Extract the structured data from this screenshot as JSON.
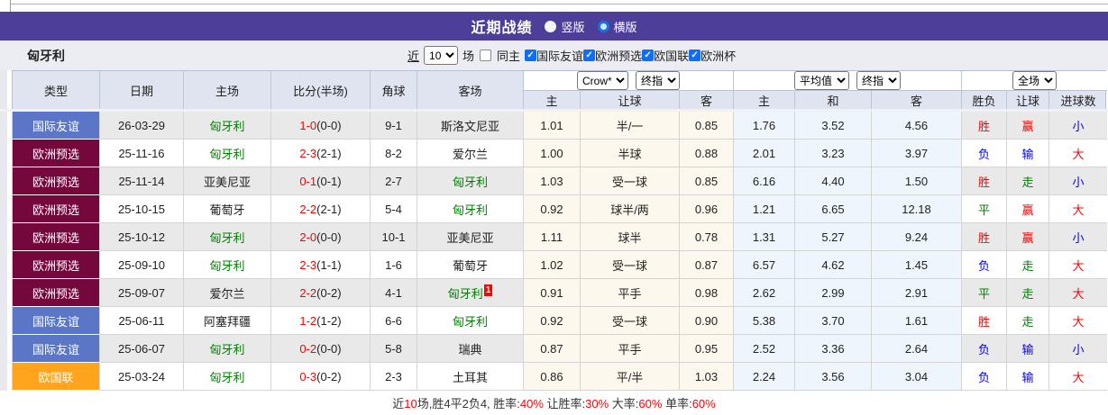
{
  "palette": {
    "accent_purple": "#4d3e99",
    "focus_team_green": "#008000",
    "score_red": "#ff0000",
    "result_colors": {
      "red": "#ff0000",
      "blue": "#0000ff",
      "green": "#008000"
    },
    "type_colors": {
      "friendly": "#5b76c6",
      "qualifier": "#74083d",
      "nations_league": "#ffa41c"
    }
  },
  "title_bar": {
    "title": "近期战绩",
    "radio_vertical_label": "竖版",
    "radio_horizontal_label": "横版"
  },
  "filter": {
    "team_name": "匈牙利",
    "near_label": "近",
    "count_value": "10",
    "unit_label": "场",
    "same_home_label": "同主",
    "competitions": [
      "国际友谊",
      "欧洲预选",
      "欧国联",
      "欧洲杯"
    ]
  },
  "table": {
    "selects": {
      "bookmaker": "Crow*",
      "handicap_index": "终指",
      "average": "平均值",
      "europe_index": "终指",
      "scope": "全场"
    },
    "headers": {
      "type": "类型",
      "date": "日期",
      "home": "主场",
      "score": "比分(半场)",
      "corner": "角球",
      "away": "客场",
      "handicap": [
        "主",
        "让球",
        "客"
      ],
      "europe": [
        "主",
        "和",
        "客"
      ],
      "outcome": [
        "胜负",
        "让球",
        "进球数"
      ]
    },
    "rows": [
      {
        "type_label": "国际友谊",
        "type_key": "friendly",
        "date": "26-03-29",
        "home": "匈牙利",
        "home_focus": true,
        "home_red_card": "",
        "score_ft": "1-0",
        "score_ht": "(0-0)",
        "corners": "9-1",
        "away": "斯洛文尼亚",
        "away_focus": false,
        "away_red_card": "",
        "handicap": [
          "1.01",
          "半/一",
          "0.85"
        ],
        "europe": [
          "1.76",
          "3.52",
          "4.56"
        ],
        "outcome": [
          {
            "text": "胜",
            "color": "red"
          },
          {
            "text": "赢",
            "color": "red"
          },
          {
            "text": "小",
            "color": "blue"
          }
        ]
      },
      {
        "type_label": "欧洲预选",
        "type_key": "qualifier",
        "date": "25-11-16",
        "home": "匈牙利",
        "home_focus": true,
        "home_red_card": "",
        "score_ft": "2-3",
        "score_ht": "(2-1)",
        "corners": "8-2",
        "away": "爱尔兰",
        "away_focus": false,
        "away_red_card": "",
        "handicap": [
          "1.00",
          "半球",
          "0.88"
        ],
        "europe": [
          "2.01",
          "3.23",
          "3.97"
        ],
        "outcome": [
          {
            "text": "负",
            "color": "blue"
          },
          {
            "text": "输",
            "color": "blue"
          },
          {
            "text": "大",
            "color": "red"
          }
        ]
      },
      {
        "type_label": "欧洲预选",
        "type_key": "qualifier",
        "date": "25-11-14",
        "home": "亚美尼亚",
        "home_focus": false,
        "home_red_card": "",
        "score_ft": "0-1",
        "score_ht": "(0-1)",
        "corners": "2-7",
        "away": "匈牙利",
        "away_focus": true,
        "away_red_card": "",
        "handicap": [
          "1.03",
          "受一球",
          "0.85"
        ],
        "europe": [
          "6.16",
          "4.40",
          "1.50"
        ],
        "outcome": [
          {
            "text": "胜",
            "color": "red"
          },
          {
            "text": "走",
            "color": "green"
          },
          {
            "text": "小",
            "color": "blue"
          }
        ]
      },
      {
        "type_label": "欧洲预选",
        "type_key": "qualifier",
        "date": "25-10-15",
        "home": "葡萄牙",
        "home_focus": false,
        "home_red_card": "",
        "score_ft": "2-2",
        "score_ht": "(2-1)",
        "corners": "5-4",
        "away": "匈牙利",
        "away_focus": true,
        "away_red_card": "",
        "handicap": [
          "0.92",
          "球半/两",
          "0.96"
        ],
        "europe": [
          "1.21",
          "6.65",
          "12.18"
        ],
        "outcome": [
          {
            "text": "平",
            "color": "green"
          },
          {
            "text": "赢",
            "color": "red"
          },
          {
            "text": "大",
            "color": "red"
          }
        ]
      },
      {
        "type_label": "欧洲预选",
        "type_key": "qualifier",
        "date": "25-10-12",
        "home": "匈牙利",
        "home_focus": true,
        "home_red_card": "",
        "score_ft": "2-0",
        "score_ht": "(0-0)",
        "corners": "10-1",
        "away": "亚美尼亚",
        "away_focus": false,
        "away_red_card": "",
        "handicap": [
          "1.11",
          "球半",
          "0.78"
        ],
        "europe": [
          "1.31",
          "5.27",
          "9.24"
        ],
        "outcome": [
          {
            "text": "胜",
            "color": "red"
          },
          {
            "text": "赢",
            "color": "red"
          },
          {
            "text": "小",
            "color": "blue"
          }
        ]
      },
      {
        "type_label": "欧洲预选",
        "type_key": "qualifier",
        "date": "25-09-10",
        "home": "匈牙利",
        "home_focus": true,
        "home_red_card": "",
        "score_ft": "2-3",
        "score_ht": "(1-1)",
        "corners": "1-6",
        "away": "葡萄牙",
        "away_focus": false,
        "away_red_card": "",
        "handicap": [
          "1.02",
          "受一球",
          "0.87"
        ],
        "europe": [
          "6.57",
          "4.62",
          "1.45"
        ],
        "outcome": [
          {
            "text": "负",
            "color": "blue"
          },
          {
            "text": "走",
            "color": "green"
          },
          {
            "text": "大",
            "color": "red"
          }
        ]
      },
      {
        "type_label": "欧洲预选",
        "type_key": "qualifier",
        "date": "25-09-07",
        "home": "爱尔兰",
        "home_focus": false,
        "home_red_card": "",
        "score_ft": "2-2",
        "score_ht": "(0-2)",
        "corners": "4-1",
        "away": "匈牙利",
        "away_focus": true,
        "away_red_card": "1",
        "handicap": [
          "0.91",
          "平手",
          "0.98"
        ],
        "europe": [
          "2.62",
          "2.99",
          "2.91"
        ],
        "outcome": [
          {
            "text": "平",
            "color": "green"
          },
          {
            "text": "走",
            "color": "green"
          },
          {
            "text": "大",
            "color": "red"
          }
        ]
      },
      {
        "type_label": "国际友谊",
        "type_key": "friendly",
        "date": "25-06-11",
        "home": "阿塞拜疆",
        "home_focus": false,
        "home_red_card": "",
        "score_ft": "1-2",
        "score_ht": "(1-2)",
        "corners": "6-6",
        "away": "匈牙利",
        "away_focus": true,
        "away_red_card": "",
        "handicap": [
          "0.92",
          "受一球",
          "0.90"
        ],
        "europe": [
          "5.38",
          "3.70",
          "1.61"
        ],
        "outcome": [
          {
            "text": "胜",
            "color": "red"
          },
          {
            "text": "走",
            "color": "green"
          },
          {
            "text": "大",
            "color": "red"
          }
        ]
      },
      {
        "type_label": "国际友谊",
        "type_key": "friendly",
        "date": "25-06-07",
        "home": "匈牙利",
        "home_focus": true,
        "home_red_card": "",
        "score_ft": "0-2",
        "score_ht": "(0-0)",
        "corners": "5-8",
        "away": "瑞典",
        "away_focus": false,
        "away_red_card": "",
        "handicap": [
          "0.87",
          "平手",
          "0.95"
        ],
        "europe": [
          "2.52",
          "3.36",
          "2.64"
        ],
        "outcome": [
          {
            "text": "负",
            "color": "blue"
          },
          {
            "text": "输",
            "color": "blue"
          },
          {
            "text": "小",
            "color": "blue"
          }
        ]
      },
      {
        "type_label": "欧国联",
        "type_key": "nations_league",
        "date": "25-03-24",
        "home": "匈牙利",
        "home_focus": true,
        "home_red_card": "",
        "score_ft": "0-3",
        "score_ht": "(0-2)",
        "corners": "2-3",
        "away": "土耳其",
        "away_focus": false,
        "away_red_card": "",
        "handicap": [
          "0.86",
          "平/半",
          "1.03"
        ],
        "europe": [
          "2.24",
          "3.56",
          "3.04"
        ],
        "outcome": [
          {
            "text": "负",
            "color": "blue"
          },
          {
            "text": "输",
            "color": "blue"
          },
          {
            "text": "大",
            "color": "red"
          }
        ]
      }
    ]
  },
  "footer": {
    "parts": [
      {
        "text": "近",
        "red": false
      },
      {
        "text": "10",
        "red": true
      },
      {
        "text": "场,胜4平2负4, 胜率:",
        "red": false
      },
      {
        "text": "40%",
        "red": true
      },
      {
        "text": " 让胜率:",
        "red": false
      },
      {
        "text": "30%",
        "red": true
      },
      {
        "text": " 大率:",
        "red": false
      },
      {
        "text": "60%",
        "red": true
      },
      {
        "text": " 单率:",
        "red": false
      },
      {
        "text": "60%",
        "red": true
      }
    ]
  }
}
